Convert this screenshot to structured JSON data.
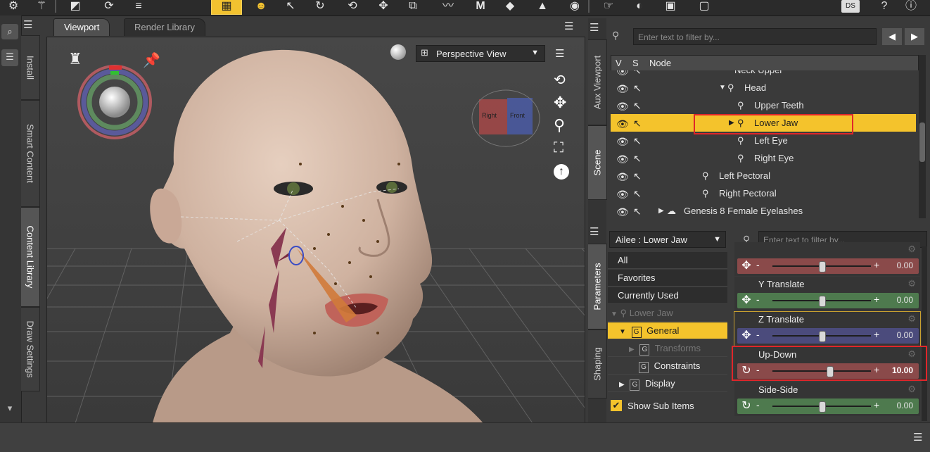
{
  "toolbar": {
    "icons": [
      "gear-icon",
      "wand-icon",
      "transform-icon",
      "refresh-icon",
      "menu-icon",
      "grid-icon",
      "smile-icon",
      "select-icon",
      "rotate-icon",
      "redo-icon",
      "move-icon",
      "scale-icon",
      "path-icon",
      "morph-icon",
      "paint-icon",
      "geometry-icon",
      "camera-icon",
      "pointer-icon",
      "render-icon",
      "render-settings-icon",
      "render-window-icon"
    ],
    "ds_label": "DS"
  },
  "left_tabs": [
    "Install",
    "Smart Content",
    "Content Library",
    "Draw Settings"
  ],
  "viewport": {
    "tabs": [
      "Viewport",
      "Render Library"
    ],
    "view_select": "Perspective View",
    "cube_labels": [
      "Right",
      "Front"
    ]
  },
  "scene": {
    "side_tabs": [
      "Aux Viewport",
      "Scene"
    ],
    "filter_placeholder": "Enter text to filter by...",
    "headers": {
      "v": "V",
      "s": "S",
      "node": "Node"
    },
    "nodes": [
      {
        "label": "Neck Upper"
      },
      {
        "label": "Head"
      },
      {
        "label": "Upper Teeth"
      },
      {
        "label": "Lower Jaw"
      },
      {
        "label": "Left Eye"
      },
      {
        "label": "Right Eye"
      },
      {
        "label": "Left Pectoral"
      },
      {
        "label": "Right Pectoral"
      },
      {
        "label": "Genesis 8 Female Eyelashes"
      }
    ]
  },
  "parameters": {
    "side_tabs": [
      "Parameters",
      "Shaping"
    ],
    "node_select": "Ailee : Lower Jaw",
    "filter_placeholder": "Enter text to filter by...",
    "categories": {
      "all": "All",
      "favorites": "Favorites",
      "currently_used": "Currently Used",
      "lower_jaw": "Lower Jaw",
      "general": "General",
      "transforms": "Transforms",
      "constraints": "Constraints",
      "display": "Display"
    },
    "badge": "G",
    "show_sub_items": "Show Sub Items",
    "params": [
      {
        "name": "",
        "value": "0.00",
        "color": "#8a4a4a",
        "icon": "move-icon",
        "level": 0.5
      },
      {
        "name": "Y Translate",
        "value": "0.00",
        "color": "#4e7a4e",
        "icon": "move-icon",
        "level": 0.5
      },
      {
        "name": "Z Translate",
        "value": "0.00",
        "color": "#4b4b7c",
        "icon": "move-icon",
        "level": 0.5
      },
      {
        "name": "Up-Down",
        "value": "10.00",
        "color": "#8a4a4a",
        "icon": "rotate-icon",
        "level": 0.58
      },
      {
        "name": "Side-Side",
        "value": "0.00",
        "color": "#4e7a4e",
        "icon": "rotate-icon",
        "level": 0.5
      }
    ],
    "slider_minus": "-",
    "slider_plus": "+"
  },
  "colors": {
    "highlight": "#f4c32c",
    "annotation": "#e0262a"
  }
}
